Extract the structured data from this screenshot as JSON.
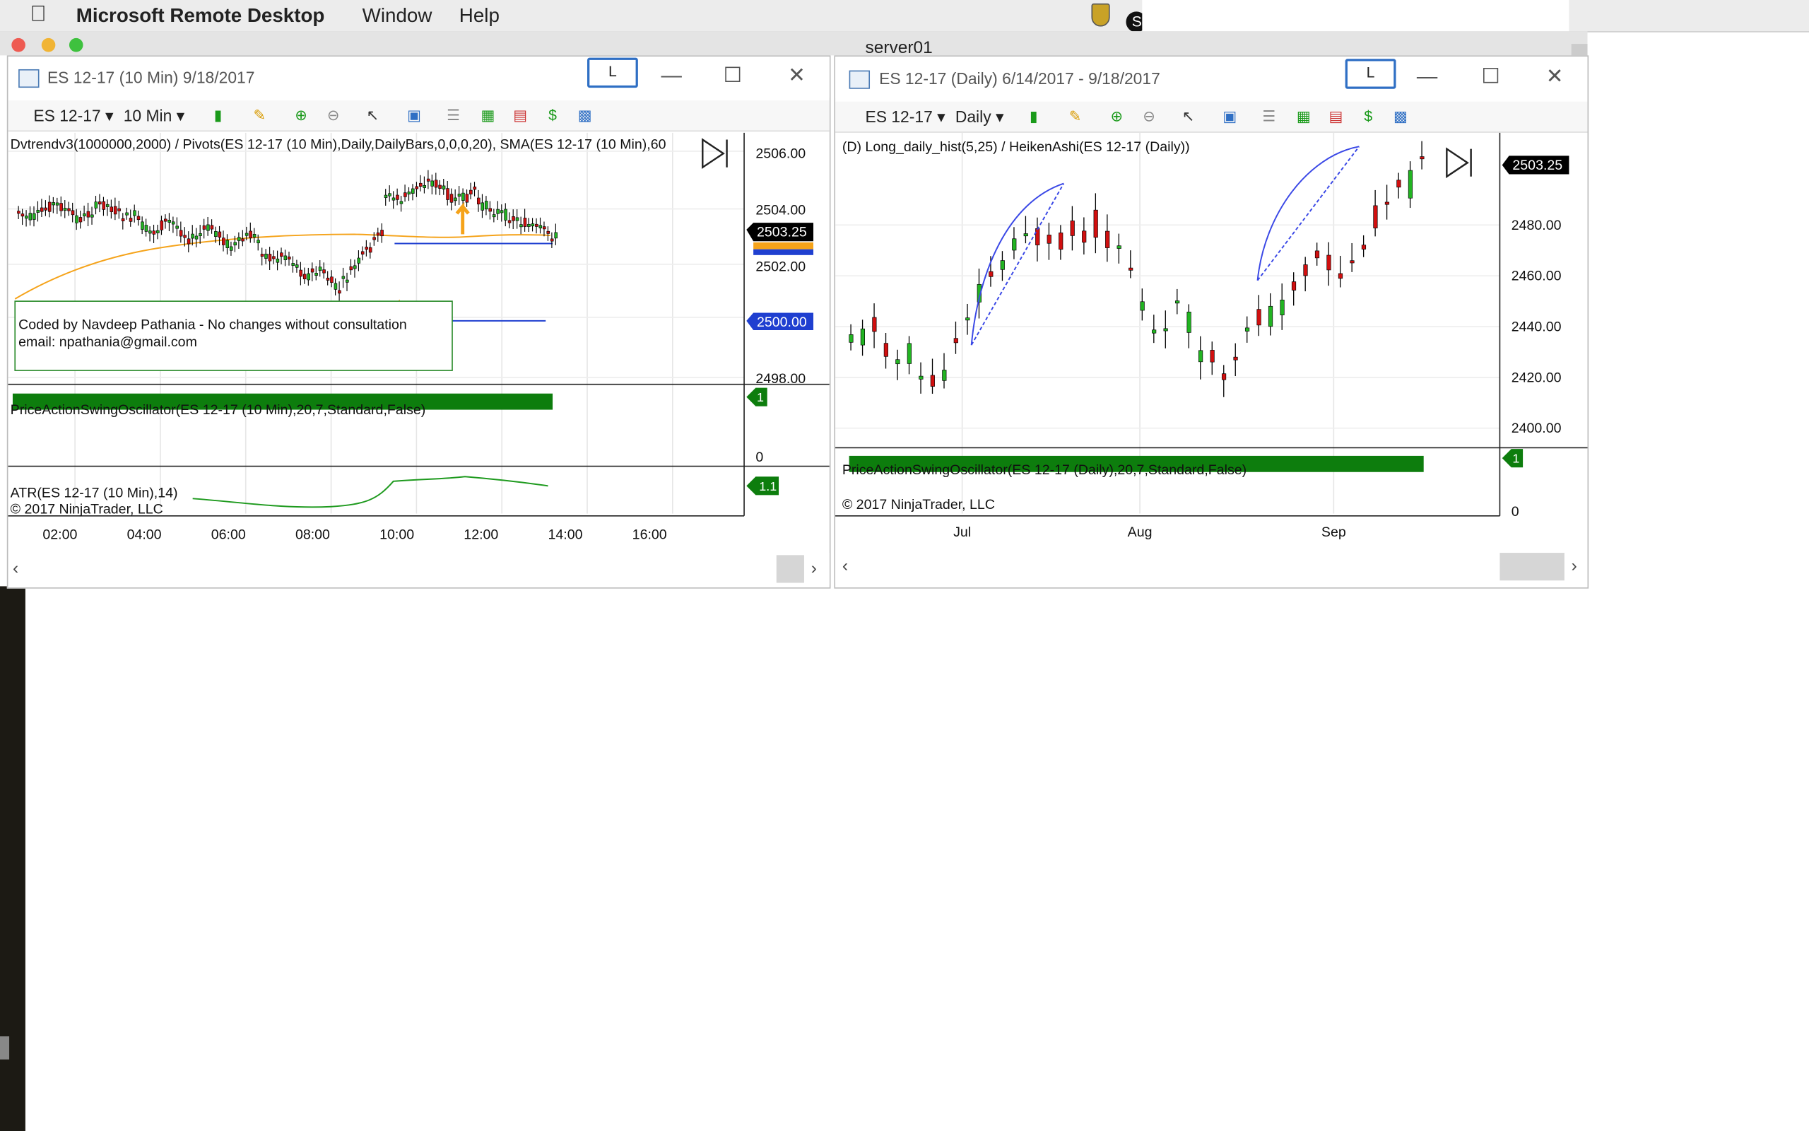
{
  "menubar": {
    "app_name": "Microsoft Remote Desktop",
    "items": [
      "Window",
      "Help"
    ]
  },
  "rdp": {
    "title": "server01"
  },
  "left_window": {
    "title": "ES 12-17 (10 Min)  9/18/2017",
    "link_button": "L",
    "toolbar": {
      "instrument": "ES 12-17",
      "interval": "10 Min"
    },
    "indicator_label": "Dvtrendv3(1000000,2000) / Pivots(ES 12-17 (10 Min),Daily,DailyBars,0,0,0,20), SMA(ES 12-17 (10 Min),60",
    "info_box": {
      "line1": "Coded by Navdeep Pathania - No changes without consultation",
      "line2": "email: npathania@gmail.com"
    },
    "price_axis": [
      "2506.00",
      "2504.00",
      "2502.00",
      "2498.00"
    ],
    "last_price": "2503.25",
    "pivot_price": "2500.00",
    "oscillator_label": "PriceActionSwingOscillator(ES 12-17 (10 Min),20,7,Standard,False)",
    "oscillator_value": "1",
    "oscillator_zero": "0",
    "atr_label": "ATR(ES 12-17 (10 Min),14)",
    "atr_value": "1.1",
    "copyright": "© 2017 NinjaTrader, LLC",
    "time_axis": [
      "02:00",
      "04:00",
      "06:00",
      "08:00",
      "10:00",
      "12:00",
      "14:00",
      "16:00"
    ]
  },
  "right_window": {
    "title": "ES 12-17 (Daily)  6/14/2017 - 9/18/2017",
    "link_button": "L",
    "toolbar": {
      "instrument": "ES 12-17",
      "interval": "Daily"
    },
    "indicator_label": "(D) Long_daily_hist(5,25) / HeikenAshi(ES 12-17 (Daily))",
    "price_axis": [
      "2480.00",
      "2460.00",
      "2440.00",
      "2420.00",
      "2400.00"
    ],
    "last_price": "2503.25",
    "oscillator_label": "PriceActionSwingOscillator(ES 12-17 (Daily),20,7,Standard,False)",
    "oscillator_value": "1",
    "oscillator_zero": "0",
    "copyright": "© 2017 NinjaTrader, LLC",
    "date_axis": [
      "Jul",
      "Aug",
      "Sep"
    ]
  },
  "colors": {
    "bull": "#22b422",
    "bear": "#d10f0f",
    "sma": "#f5a31a",
    "pivot": "#1f3fd0",
    "osc": "#0d7d0d",
    "atr": "#1e9a1e",
    "link_border": "#2f6fc4"
  }
}
